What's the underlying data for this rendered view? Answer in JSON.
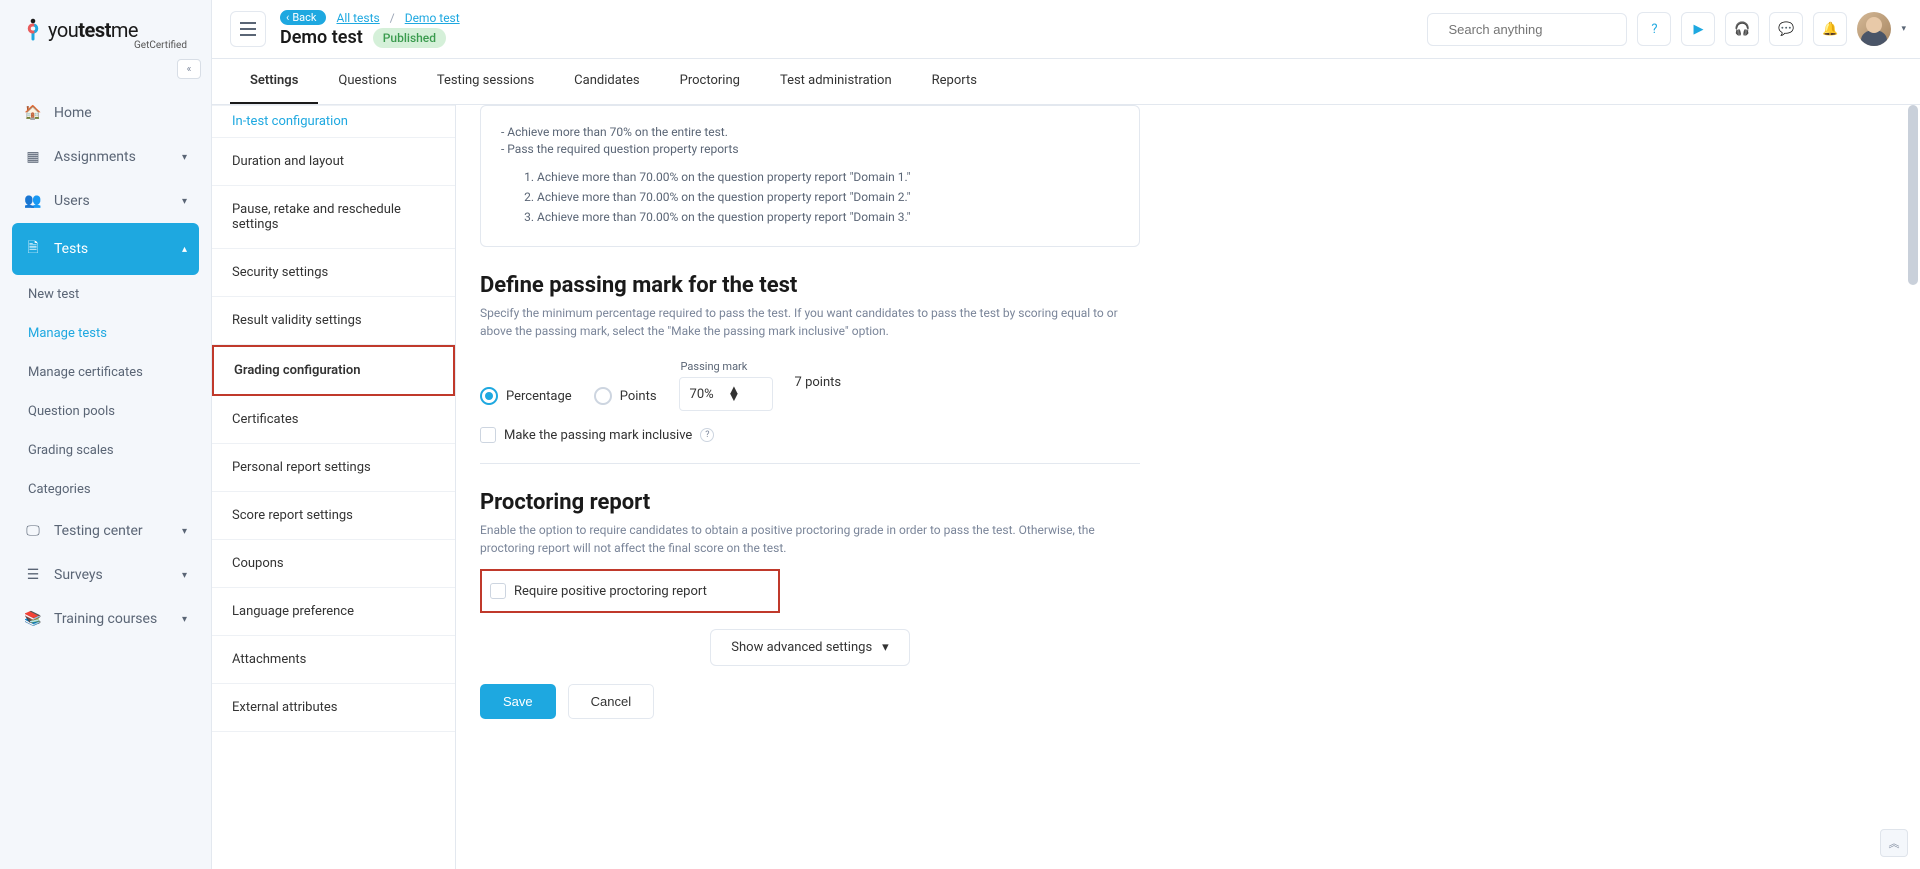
{
  "brand": {
    "name_a": "you",
    "name_b": "test",
    "name_c": "me",
    "sub": "GetCertified"
  },
  "sidebar": {
    "items": [
      {
        "label": "Home",
        "icon": "home"
      },
      {
        "label": "Assignments",
        "icon": "grid",
        "caret": true
      },
      {
        "label": "Users",
        "icon": "users",
        "caret": true
      },
      {
        "label": "Tests",
        "icon": "copy",
        "caret": true,
        "active": true
      },
      {
        "label": "Testing center",
        "icon": "monitor",
        "caret": true
      },
      {
        "label": "Surveys",
        "icon": "list",
        "caret": true
      },
      {
        "label": "Training courses",
        "icon": "book",
        "caret": true
      }
    ],
    "tests_sub": [
      "New test",
      "Manage tests",
      "Manage certificates",
      "Question pools",
      "Grading scales",
      "Categories"
    ]
  },
  "breadcrumb": {
    "back": "Back",
    "links": [
      "All tests",
      "Demo test"
    ]
  },
  "page": {
    "title": "Demo test",
    "status": "Published"
  },
  "search": {
    "placeholder": "Search anything"
  },
  "tabs": [
    "Settings",
    "Questions",
    "Testing sessions",
    "Candidates",
    "Proctoring",
    "Test administration",
    "Reports"
  ],
  "settings_nav": [
    "In-test configuration",
    "Duration and layout",
    "Pause, retake and reschedule settings",
    "Security settings",
    "Result validity settings",
    "Grading configuration",
    "Certificates",
    "Personal report settings",
    "Score report settings",
    "Coupons",
    "Language preference",
    "Attachments",
    "External attributes"
  ],
  "info_box": {
    "bullets": [
      "- Achieve more than 70% on the entire test.",
      "- Pass the required question property reports"
    ],
    "numbered": [
      "Achieve more than 70.00% on the question property report \"Domain 1.\"",
      "Achieve more than 70.00% on the question property report \"Domain 2.\"",
      "Achieve more than 70.00% on the question property report \"Domain 3.\""
    ]
  },
  "passing": {
    "title": "Define passing mark for the test",
    "desc": "Specify the minimum percentage required to pass the test. If you want candidates to pass the test by scoring equal to or above the passing mark, select the \"Make the passing mark inclusive\" option.",
    "opt_percentage": "Percentage",
    "opt_points": "Points",
    "pm_label": "Passing mark",
    "pm_value": "70%",
    "points_text": "7 points",
    "inclusive_label": "Make the passing mark inclusive"
  },
  "proctoring": {
    "title": "Proctoring report",
    "desc": "Enable the option to require candidates to obtain a positive proctoring grade in order to pass the test. Otherwise, the proctoring report will not affect the final score on the test.",
    "checkbox_label": "Require positive proctoring report"
  },
  "advanced": "Show advanced settings",
  "buttons": {
    "save": "Save",
    "cancel": "Cancel"
  }
}
